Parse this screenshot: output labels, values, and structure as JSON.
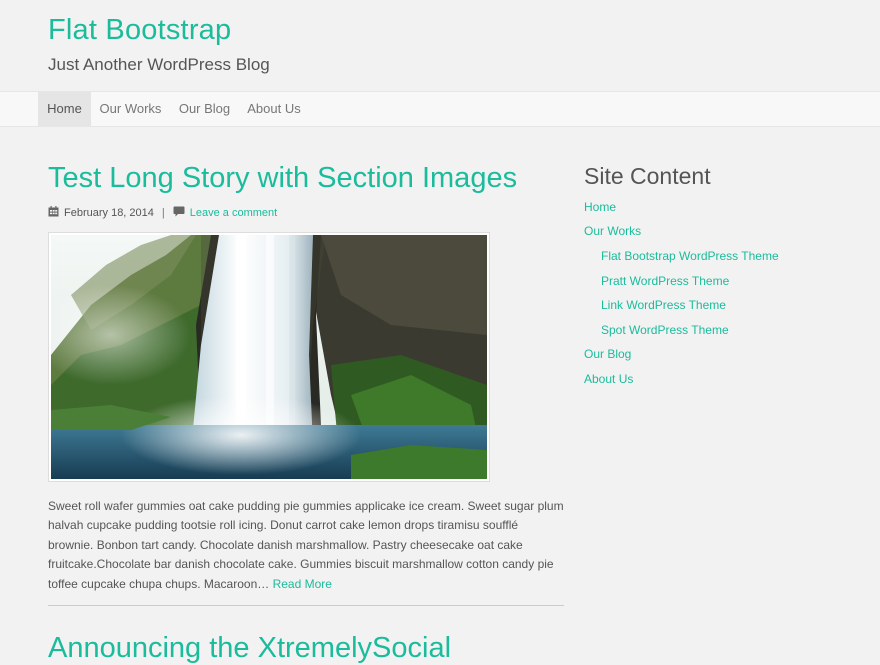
{
  "header": {
    "site_title": "Flat Bootstrap",
    "tagline": "Just Another WordPress Blog"
  },
  "nav": {
    "items": [
      {
        "label": "Home",
        "active": true
      },
      {
        "label": "Our Works",
        "active": false
      },
      {
        "label": "Our Blog",
        "active": false
      },
      {
        "label": "About Us",
        "active": false
      }
    ]
  },
  "post": {
    "title": "Test Long Story with Section Images",
    "date": "February 18, 2014",
    "separator": "|",
    "comment_link": "Leave a comment",
    "excerpt": "Sweet roll wafer gummies oat cake pudding pie gummies applicake ice cream. Sweet sugar plum halvah cupcake pudding tootsie roll icing. Donut carrot cake lemon drops tiramisu soufflé brownie. Bonbon tart candy. Chocolate danish marshmallow. Pastry cheesecake oat cake fruitcake.Chocolate bar danish chocolate cake. Gummies biscuit marshmallow cotton candy pie toffee cupcake chupa chups. Macaroon…",
    "read_more": "Read More",
    "icons": {
      "date": "calendar-icon",
      "comment": "comment-icon"
    }
  },
  "next_post": {
    "title": "Announcing the XtremelySocial"
  },
  "sidebar": {
    "title": "Site Content",
    "links": [
      {
        "label": "Home",
        "level": 0
      },
      {
        "label": "Our Works",
        "level": 0
      },
      {
        "label": "Flat Bootstrap WordPress Theme",
        "level": 1
      },
      {
        "label": "Pratt WordPress Theme",
        "level": 1
      },
      {
        "label": "Link WordPress Theme",
        "level": 1
      },
      {
        "label": "Spot WordPress Theme",
        "level": 1
      },
      {
        "label": "Our Blog",
        "level": 0
      },
      {
        "label": "About Us",
        "level": 0
      }
    ]
  },
  "colors": {
    "accent": "#1abc9c",
    "text": "#555555",
    "background": "#f2f2f2"
  }
}
